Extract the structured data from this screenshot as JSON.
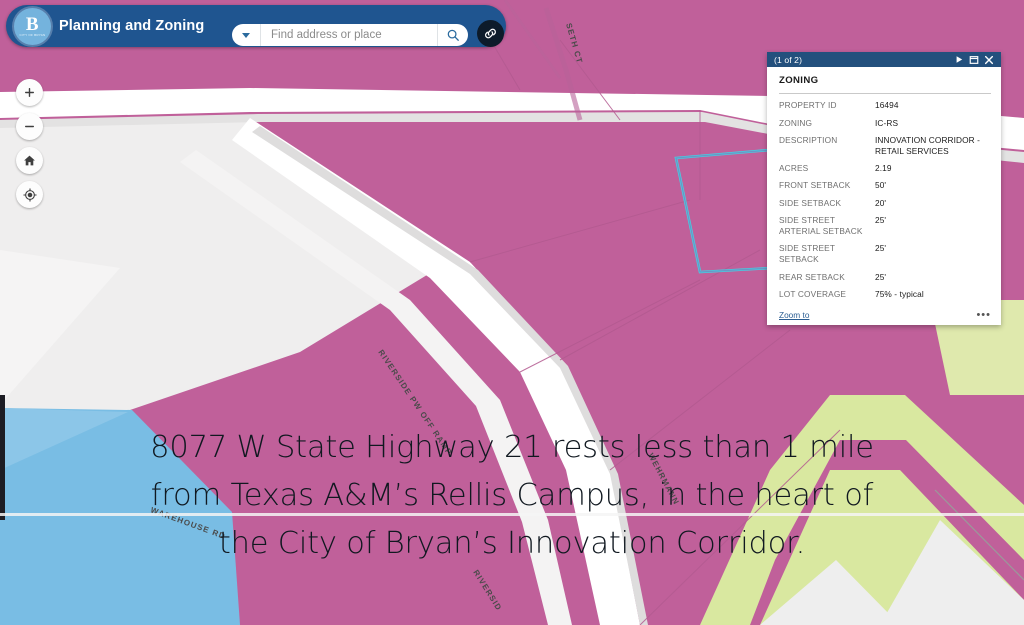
{
  "header": {
    "app_title": "Planning and Zoning",
    "logo_letter": "B",
    "logo_sub": "CITY OF BRYAN",
    "search_placeholder": "Find address or place",
    "search_value": "",
    "dropdown_icon": "chevron-down-icon",
    "search_icon": "search-icon",
    "link_icon": "link-icon",
    "bar_color": "#1f5590",
    "logo_color": "#74b3dd"
  },
  "map_tools": [
    {
      "name": "zoom-in-button",
      "glyph": "+",
      "label": "Zoom in"
    },
    {
      "name": "zoom-out-button",
      "glyph": "−",
      "label": "Zoom out"
    },
    {
      "name": "home-button",
      "glyph": "⌂",
      "label": "Default extent"
    },
    {
      "name": "locate-button",
      "glyph": "◉",
      "label": "Find my location"
    }
  ],
  "popup": {
    "counter": "(1 of 2)",
    "next_icon": "next-arrow-icon",
    "maximize_icon": "maximize-icon",
    "close_icon": "close-icon",
    "heading": "ZONING",
    "attributes": [
      {
        "label": "PROPERTY ID",
        "value": "16494"
      },
      {
        "label": "ZONING",
        "value": "IC-RS"
      },
      {
        "label": "DESCRIPTION",
        "value": "INNOVATION CORRIDOR - RETAIL SERVICES"
      },
      {
        "label": "ACRES",
        "value": "2.19"
      },
      {
        "label": "FRONT SETBACK",
        "value": "50'"
      },
      {
        "label": "SIDE SETBACK",
        "value": "20'"
      },
      {
        "label": "SIDE STREET ARTERIAL SETBACK",
        "value": "25'"
      },
      {
        "label": "SIDE STREET SETBACK",
        "value": "25'"
      },
      {
        "label": "REAR SETBACK",
        "value": "25'"
      },
      {
        "label": "LOT COVERAGE",
        "value": "75% - typical"
      }
    ],
    "zoom_to_label": "Zoom to",
    "more_label": "•••",
    "titlebar_color": "#23507d"
  },
  "caption": {
    "line1": "8077 W State Highway 21 rests less than 1 mile",
    "line2": "from Texas A&M’s Rellis Campus, in the heart of",
    "line3": "the City of Bryan’s Innovation Corridor."
  },
  "map": {
    "zone_colors": {
      "commercial_magenta": "#c0609a",
      "residential_green": "#d9e8a0",
      "industrial_blue": "#79bde4",
      "basemap_gray": "#efeeee",
      "road_white": "#ffffff",
      "selection_cyan": "#3fd7e8"
    },
    "street_labels": [
      {
        "name": "street-label-seth-ct",
        "text": "SETH CT"
      },
      {
        "name": "street-label-riverside-pw-off-ramp",
        "text": "RIVERSIDE PW OFF RAMP"
      },
      {
        "name": "street-label-wehrmann",
        "text": "WEHRMANN"
      },
      {
        "name": "street-label-warehouse-rd",
        "text": "WAREHOUSE RD"
      },
      {
        "name": "street-label-riverside",
        "text": "RIVERSIDE"
      }
    ]
  }
}
